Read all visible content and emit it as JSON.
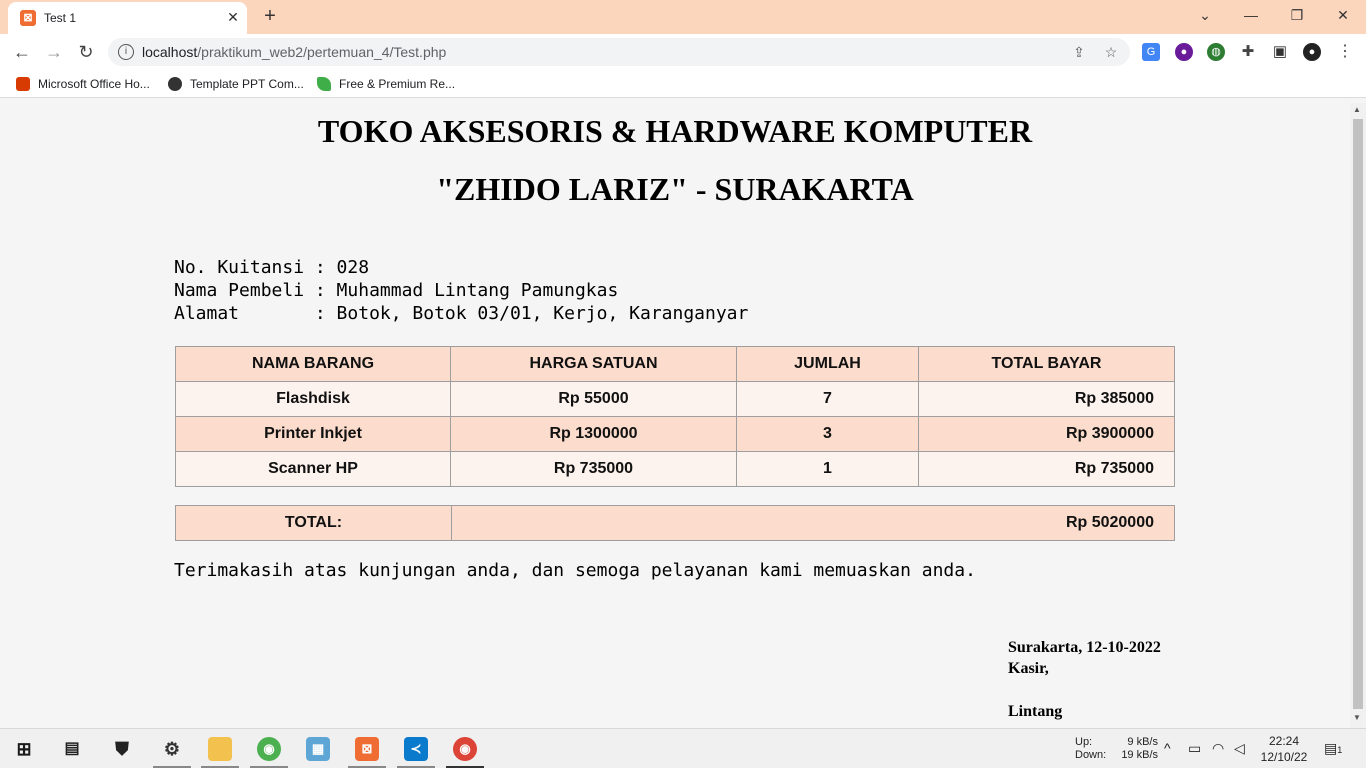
{
  "browser": {
    "tab": {
      "title": "Test 1",
      "favicon": "xampp-icon"
    },
    "url_host": "localhost",
    "url_path": "/praktikum_web2/pertemuan_4/Test.php",
    "bookmarks": [
      {
        "label": "Microsoft Office Ho...",
        "icon": "office-icon",
        "color": "#d83b01"
      },
      {
        "label": "Template PPT Com...",
        "icon": "globe-icon",
        "color": "#333333"
      },
      {
        "label": "Free & Premium Re...",
        "icon": "leaf-icon",
        "color": "#3fae49"
      }
    ]
  },
  "page": {
    "title_line1": "TOKO AKSESORIS & HARDWARE KOMPUTER",
    "title_line2": "\"ZHIDO LARIZ\" - SURAKARTA",
    "receipt_no_line": "No. Kuitansi : 028",
    "buyer_line": "Nama Pembeli : Muhammad Lintang Pamungkas",
    "address_line": "Alamat       : Botok, Botok 03/01, Kerjo, Karanganyar",
    "table": {
      "headers": [
        "NAMA BARANG",
        "HARGA SATUAN",
        "JUMLAH",
        "TOTAL BAYAR"
      ],
      "rows": [
        {
          "name": "Flashdisk",
          "price": "Rp 55000",
          "qty": "7",
          "total": "Rp 385000"
        },
        {
          "name": "Printer Inkjet",
          "price": "Rp 1300000",
          "qty": "3",
          "total": "Rp 3900000"
        },
        {
          "name": "Scanner HP",
          "price": "Rp 735000",
          "qty": "1",
          "total": "Rp 735000"
        }
      ]
    },
    "total_label": "TOTAL:",
    "total_value": "Rp 5020000",
    "thanks": "Terimakasih atas kunjungan anda, dan semoga pelayanan kami memuaskan anda.",
    "sign_place_date": "Surakarta, 12-10-2022",
    "sign_role": "Kasir,",
    "sign_name": "Lintang"
  },
  "taskbar": {
    "net_up_label": "Up:",
    "net_down_label": "Down:",
    "net_up": "9 kB/s",
    "net_down": "19 kB/s",
    "time": "22:24",
    "date": "12/10/22",
    "notification_count": "1"
  }
}
